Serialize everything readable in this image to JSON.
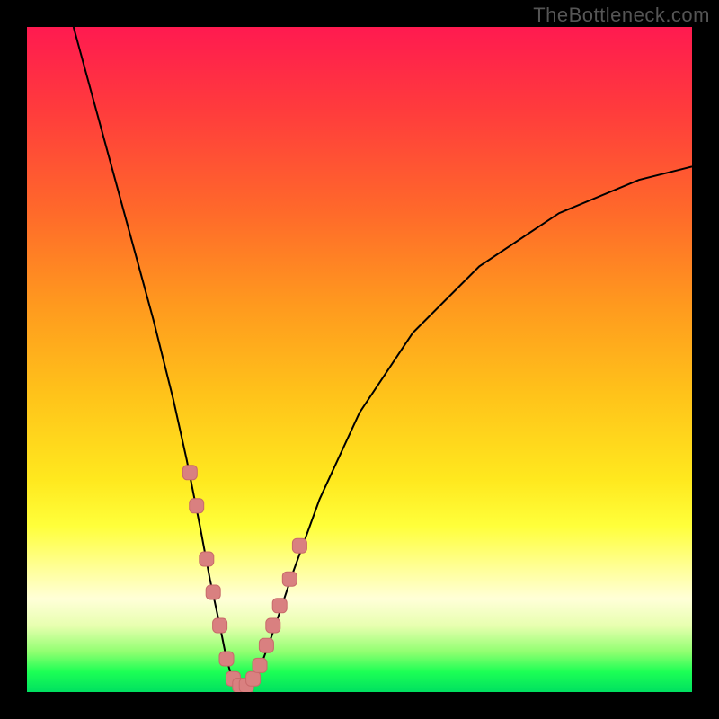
{
  "watermark": "TheBottleneck.com",
  "colors": {
    "frame": "#000000",
    "curve": "#000000",
    "marker_fill": "#d98080",
    "marker_stroke": "#c86a6a"
  },
  "chart_data": {
    "type": "line",
    "title": "",
    "xlabel": "",
    "ylabel": "",
    "xlim": [
      0,
      100
    ],
    "ylim": [
      0,
      100
    ],
    "grid": false,
    "legend": false,
    "series": [
      {
        "name": "bottleneck-curve",
        "x": [
          7,
          10,
          13,
          16,
          19,
          22,
          24,
          26,
          27.5,
          29,
          30,
          31,
          32,
          33.5,
          35,
          37,
          40,
          44,
          50,
          58,
          68,
          80,
          92,
          100
        ],
        "y": [
          100,
          89,
          78,
          67,
          56,
          44,
          35,
          25,
          17,
          10,
          5,
          1.5,
          1,
          1.2,
          3.5,
          9,
          18,
          29,
          42,
          54,
          64,
          72,
          77,
          79
        ]
      }
    ],
    "markers": {
      "name": "highlight-points",
      "x": [
        24.5,
        25.5,
        27.0,
        28.0,
        29.0,
        30.0,
        31.0,
        32.0,
        33.0,
        34.0,
        35.0,
        36.0,
        37.0,
        38.0,
        39.5,
        41.0
      ],
      "y": [
        33,
        28,
        20,
        15,
        10,
        5,
        2,
        1,
        1,
        2,
        4,
        7,
        10,
        13,
        17,
        22
      ]
    }
  }
}
